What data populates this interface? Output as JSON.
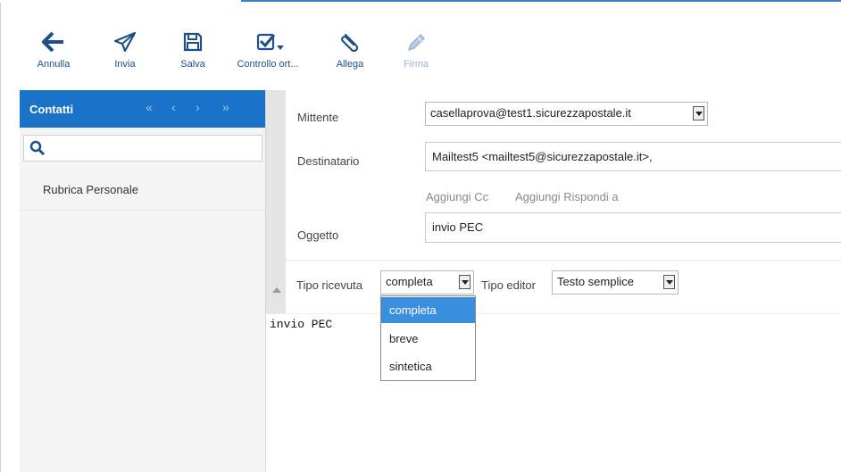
{
  "toolbar": {
    "annulla": "Annulla",
    "invia": "Invia",
    "salva": "Salva",
    "controllo": "Controllo ort...",
    "allega": "Allega",
    "firma": "Firma"
  },
  "sidebar": {
    "title": "Contatti",
    "nav": [
      "«",
      "‹",
      "›",
      "»"
    ],
    "search_placeholder": "",
    "items": [
      {
        "label": "Rubrica Personale"
      }
    ]
  },
  "form": {
    "mittente_label": "Mittente",
    "mittente_value": "casellaprova@test1.sicurezzapostale.it",
    "destinatario_label": "Destinatario",
    "destinatario_value": "Mailtest5 <mailtest5@sicurezzapostale.it>,",
    "aggiungi_cc": "Aggiungi Cc",
    "aggiungi_rispondi": "Aggiungi Rispondi a",
    "oggetto_label": "Oggetto",
    "oggetto_value": "invio PEC",
    "tipo_ricevuta_label": "Tipo ricevuta",
    "tipo_ricevuta_value": "completa",
    "tipo_editor_label": "Tipo editor",
    "tipo_editor_value": "Testo semplice"
  },
  "editor": {
    "body": "invio PEC"
  },
  "dropdown": {
    "options": [
      {
        "label": "completa",
        "selected": true
      },
      {
        "label": "breve",
        "selected": false
      },
      {
        "label": "sintetica",
        "selected": false
      }
    ]
  },
  "colors": {
    "accent": "#1a73c8",
    "toolbar_icon": "#1f4f8a",
    "selection": "#3a8ede"
  }
}
